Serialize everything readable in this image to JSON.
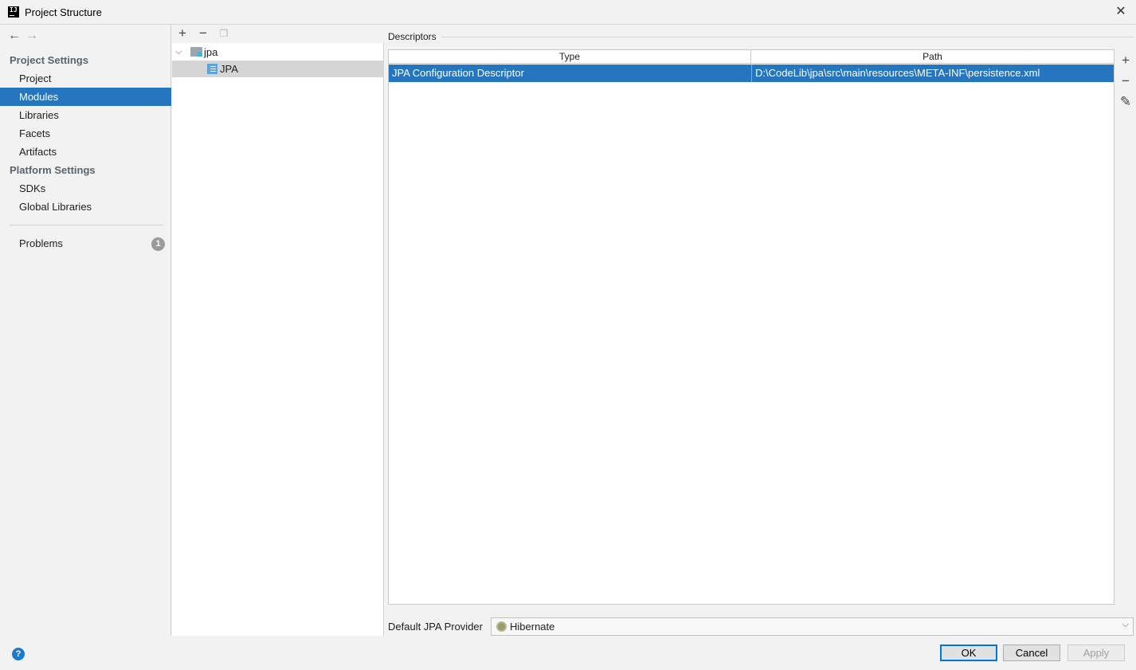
{
  "window": {
    "title": "Project Structure",
    "app_icon_text": "IJ"
  },
  "nav": {
    "back_icon": "←",
    "forward_icon": "→",
    "project_settings_header": "Project Settings",
    "project_items": [
      "Project",
      "Modules",
      "Libraries",
      "Facets",
      "Artifacts"
    ],
    "selected_item": "Modules",
    "platform_settings_header": "Platform Settings",
    "platform_items": [
      "SDKs",
      "Global Libraries"
    ],
    "problems_label": "Problems",
    "problems_count": "1"
  },
  "tree": {
    "add_icon": "+",
    "remove_icon": "−",
    "copy_icon": "❐",
    "module_name": "jpa",
    "facet_name": "JPA"
  },
  "descriptors": {
    "section_label": "Descriptors",
    "columns": [
      "Type",
      "Path"
    ],
    "rows": [
      {
        "type": "JPA Configuration Descriptor",
        "path": "D:\\CodeLib\\jpa\\src\\main\\resources\\META-INF\\persistence.xml"
      }
    ],
    "add_icon": "+",
    "remove_icon": "−",
    "edit_icon": "✎"
  },
  "provider": {
    "label": "Default JPA Provider",
    "value": "Hibernate"
  },
  "buttons": {
    "help": "?",
    "ok": "OK",
    "cancel": "Cancel",
    "apply": "Apply"
  },
  "colors": {
    "selection": "#2675bf",
    "panel_bg": "#f2f2f2",
    "ok_border": "#0078d7"
  }
}
